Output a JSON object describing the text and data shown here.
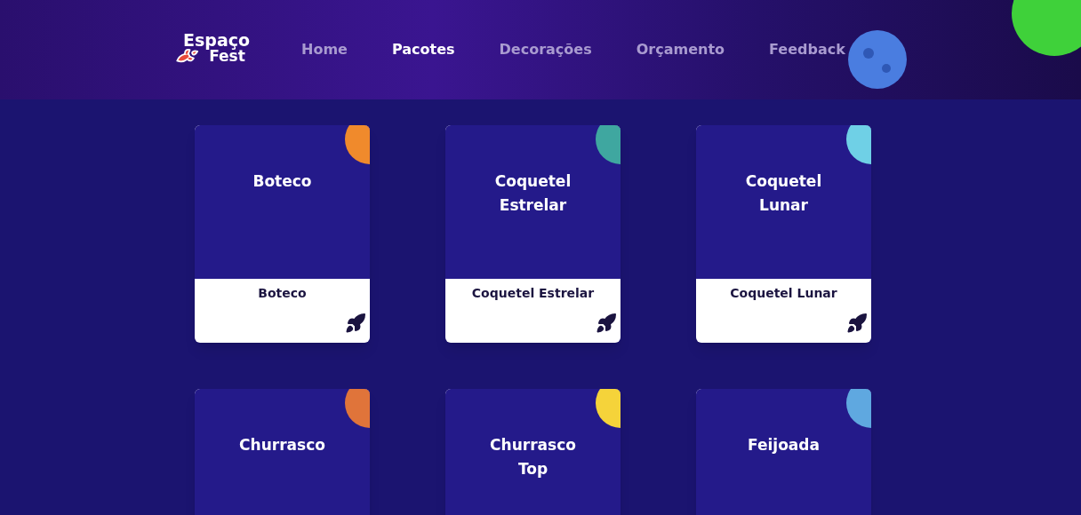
{
  "logo": {
    "line_1": "Espaço",
    "line_2": "Fest"
  },
  "nav": [
    {
      "label": "Home",
      "selected": false
    },
    {
      "label": "Pacotes",
      "selected": true
    },
    {
      "label": "Decorações",
      "selected": false
    },
    {
      "label": "Orçamento",
      "selected": false
    },
    {
      "label": "Feedback",
      "selected": false
    }
  ],
  "packages": [
    {
      "image_title": "Boteco",
      "caption": "Boteco"
    },
    {
      "image_title": "Coquetel Estrelar",
      "caption": "Coquetel Estrelar"
    },
    {
      "image_title": "Coquetel Lunar",
      "caption": "Coquetel Lunar"
    },
    {
      "image_title": "Churrasco"
    },
    {
      "image_title": "Churrasco Top"
    },
    {
      "image_title": "Feijoada"
    }
  ]
}
